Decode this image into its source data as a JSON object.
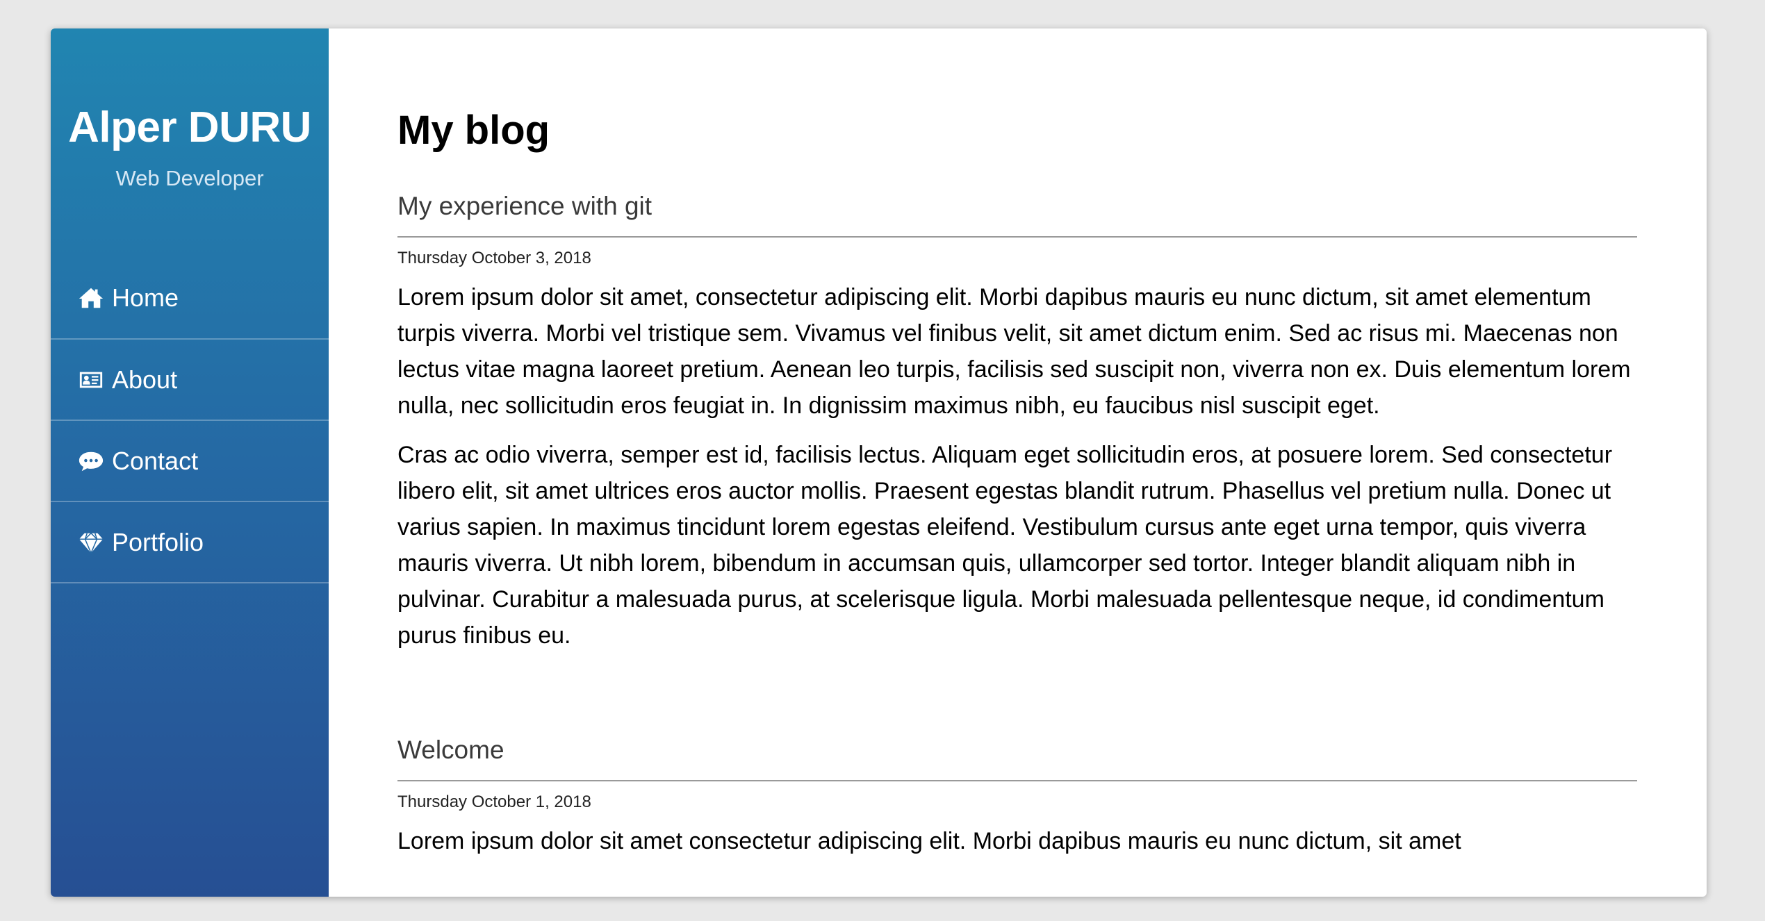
{
  "sidebar": {
    "name": "Alper DURU",
    "role": "Web Developer",
    "items": [
      {
        "label": "Home",
        "icon": "home-icon"
      },
      {
        "label": "About",
        "icon": "id-card-icon"
      },
      {
        "label": "Contact",
        "icon": "chat-bubble-icon"
      },
      {
        "label": "Portfolio",
        "icon": "diamond-icon"
      }
    ]
  },
  "main": {
    "title": "My blog",
    "posts": [
      {
        "title": "My experience with git",
        "date": "Thursday October 3, 2018",
        "paragraphs": [
          "Lorem ipsum dolor sit amet, consectetur adipiscing elit. Morbi dapibus mauris eu nunc dictum, sit amet elementum turpis viverra. Morbi vel tristique sem. Vivamus vel finibus velit, sit amet dictum enim. Sed ac risus mi. Maecenas non lectus vitae magna laoreet pretium. Aenean leo turpis, facilisis sed suscipit non, viverra non ex. Duis elementum lorem nulla, nec sollicitudin eros feugiat in. In dignissim maximus nibh, eu faucibus nisl suscipit eget.",
          "Cras ac odio viverra, semper est id, facilisis lectus. Aliquam eget sollicitudin eros, at posuere lorem. Sed consectetur libero elit, sit amet ultrices eros auctor mollis. Praesent egestas blandit rutrum. Phasellus vel pretium nulla. Donec ut varius sapien. In maximus tincidunt lorem egestas eleifend. Vestibulum cursus ante eget urna tempor, quis viverra mauris viverra. Ut nibh lorem, bibendum in accumsan quis, ullamcorper sed tortor. Integer blandit aliquam nibh in pulvinar. Curabitur a malesuada purus, at scelerisque ligula. Morbi malesuada pellentesque neque, id condimentum purus finibus eu."
        ]
      },
      {
        "title": "Welcome",
        "date": "Thursday October 1, 2018",
        "paragraphs": [
          "Lorem ipsum dolor sit amet consectetur adipiscing elit. Morbi dapibus mauris eu nunc dictum, sit amet"
        ]
      }
    ]
  },
  "colors": {
    "sidebar_top": "#2185b1",
    "sidebar_bottom": "#264f93",
    "page_background": "#e8e8e8",
    "content_background": "#ffffff"
  }
}
